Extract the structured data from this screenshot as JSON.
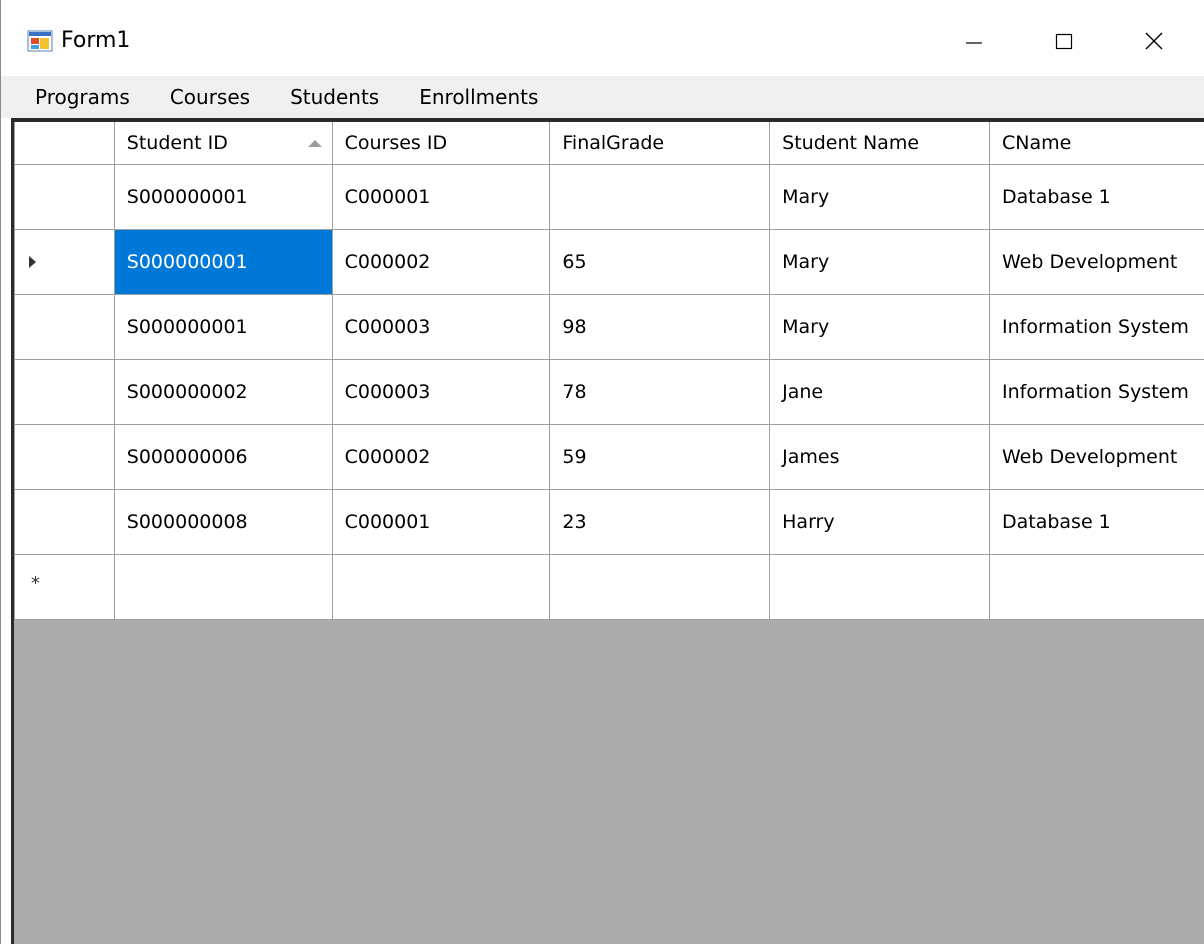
{
  "window": {
    "title": "Form1",
    "icon": "winforms-app-icon",
    "controls": {
      "minimize": "minimize-icon",
      "maximize": "maximize-icon",
      "close": "close-icon"
    }
  },
  "menu": {
    "items": [
      {
        "label": "Programs"
      },
      {
        "label": "Courses"
      },
      {
        "label": "Students"
      },
      {
        "label": "Enrollments"
      }
    ]
  },
  "grid": {
    "columns": [
      {
        "label": "Student ID",
        "sorted": "ascending"
      },
      {
        "label": "Courses ID"
      },
      {
        "label": "FinalGrade"
      },
      {
        "label": "Student Name"
      },
      {
        "label": "CName"
      }
    ],
    "rows": [
      {
        "cells": [
          "S000000001",
          "C000001",
          "",
          "Mary",
          "Database 1"
        ]
      },
      {
        "cells": [
          "S000000001",
          "C000002",
          "65",
          "Mary",
          "Web Development"
        ],
        "current": true
      },
      {
        "cells": [
          "S000000001",
          "C000003",
          "98",
          "Mary",
          "Information System"
        ]
      },
      {
        "cells": [
          "S000000002",
          "C000003",
          "78",
          "Jane",
          "Information System"
        ]
      },
      {
        "cells": [
          "S000000006",
          "C000002",
          "59",
          "James",
          "Web Development"
        ]
      },
      {
        "cells": [
          "S000000008",
          "C000001",
          "23",
          "Harry",
          "Database 1"
        ]
      }
    ],
    "new_row_marker": "*",
    "selection_color": "#0078d7",
    "background_color": "#ababab"
  }
}
